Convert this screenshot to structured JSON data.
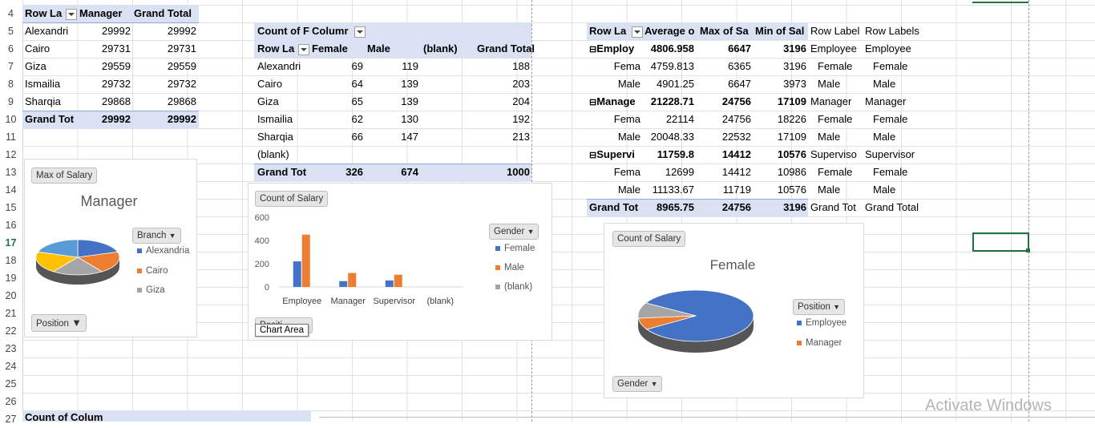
{
  "colors": {
    "blue": "#4472c4",
    "orange": "#ed7d31",
    "gray": "#a5a5a5",
    "yellow": "#ffc000",
    "lightblue": "#5b9bd5",
    "green": "#217346",
    "header_band": "#d9e1f2"
  },
  "row_numbers": [
    "4",
    "5",
    "6",
    "7",
    "8",
    "9",
    "10",
    "11",
    "12",
    "13",
    "14",
    "15",
    "16",
    "17",
    "18",
    "19",
    "20",
    "21",
    "22",
    "23",
    "24",
    "25",
    "26",
    "27"
  ],
  "pivot1": {
    "headers": [
      "Row La",
      "Manager",
      "Grand Total"
    ],
    "rows": [
      [
        "Alexandri",
        "29992",
        "29992"
      ],
      [
        "Cairo",
        "29731",
        "29731"
      ],
      [
        "Giza",
        "29559",
        "29559"
      ],
      [
        "Ismailia",
        "29732",
        "29732"
      ],
      [
        "Sharqia",
        "29868",
        "29868"
      ]
    ],
    "total": [
      "Grand Tot",
      "29992",
      "29992"
    ]
  },
  "pivot2": {
    "top_left": "Count of F",
    "top_right": "Columr",
    "headers": [
      "Row La",
      "Female",
      "Male",
      "(blank)",
      "Grand Total"
    ],
    "rows": [
      [
        "Alexandri",
        "69",
        "119",
        "",
        "188"
      ],
      [
        "Cairo",
        "64",
        "139",
        "",
        "203"
      ],
      [
        "Giza",
        "65",
        "139",
        "",
        "204"
      ],
      [
        "Ismailia",
        "62",
        "130",
        "",
        "192"
      ],
      [
        "Sharqia",
        "66",
        "147",
        "",
        "213"
      ],
      [
        "(blank)",
        "",
        "",
        "",
        ""
      ]
    ],
    "total": [
      "Grand Tot",
      "326",
      "674",
      "",
      "1000"
    ]
  },
  "pivot3": {
    "headers": [
      "Row La",
      "Average o",
      "Max of Sa",
      "Min of Sal",
      "Row Label",
      "Row Labels"
    ],
    "rows": [
      {
        "label": "Employ",
        "vals": [
          "4806.958",
          "6647",
          "3196"
        ],
        "e": "Employee",
        "f": "Employee",
        "group": true
      },
      {
        "label": "Fema",
        "vals": [
          "4759.813",
          "6365",
          "3196"
        ],
        "e": "Female",
        "f": "Female",
        "group": false
      },
      {
        "label": "Male",
        "vals": [
          "4901.25",
          "6647",
          "3973"
        ],
        "e": "Male",
        "f": "Male",
        "group": false
      },
      {
        "label": "Manage",
        "vals": [
          "21228.71",
          "24756",
          "17109"
        ],
        "e": "Manager",
        "f": "Manager",
        "group": true
      },
      {
        "label": "Fema",
        "vals": [
          "22114",
          "24756",
          "18226"
        ],
        "e": "Female",
        "f": "Female",
        "group": false
      },
      {
        "label": "Male",
        "vals": [
          "20048.33",
          "22532",
          "17109"
        ],
        "e": "Male",
        "f": "Male",
        "group": false
      },
      {
        "label": "Supervi",
        "vals": [
          "11759.8",
          "14412",
          "10576"
        ],
        "e": "Superviso",
        "f": "Supervisor",
        "group": true
      },
      {
        "label": "Fema",
        "vals": [
          "12699",
          "14412",
          "10986"
        ],
        "e": "Female",
        "f": "Female",
        "group": false
      },
      {
        "label": "Male",
        "vals": [
          "11133.67",
          "11719",
          "10576"
        ],
        "e": "Male",
        "f": "Male",
        "group": false
      }
    ],
    "total": {
      "label": "Grand Tot",
      "vals": [
        "8965.75",
        "24756",
        "3196"
      ],
      "e": "Grand Tot",
      "f": "Grand Total"
    }
  },
  "bottom_cut": "Count of  Colum",
  "chart1": {
    "button_top": "Max of Salary",
    "title": "Manager",
    "legend_button": "Branch",
    "legend": [
      "Alexandria",
      "Cairo",
      "Giza"
    ],
    "button_bottom": "Position"
  },
  "chart2": {
    "button_top": "Count of Salary",
    "legend_button": "Gender",
    "legend": [
      "Female",
      "Male",
      "(blank)"
    ],
    "tooltip": "Chart Area",
    "button_bottom": "Positi"
  },
  "chart3": {
    "button_top": "Count of Salary",
    "title": "Female",
    "legend_button": "Position",
    "legend": [
      "Employee",
      "Manager"
    ],
    "button_bottom": "Gender"
  },
  "chart_data": [
    {
      "type": "pie",
      "title": "Manager",
      "categories": [
        "Alexandria",
        "Cairo",
        "Giza",
        "Ismailia",
        "Sharqia"
      ],
      "values": [
        29992,
        29731,
        29559,
        29732,
        29868
      ]
    },
    {
      "type": "bar",
      "title": "",
      "categories": [
        "Employee",
        "Manager",
        "Supervisor",
        "(blank)"
      ],
      "series": [
        {
          "name": "Female",
          "values": [
            220,
            50,
            56,
            0
          ]
        },
        {
          "name": "Male",
          "values": [
            450,
            120,
            105,
            0
          ]
        },
        {
          "name": "(blank)",
          "values": [
            0,
            0,
            0,
            0
          ]
        }
      ],
      "ylim": [
        0,
        600
      ],
      "yticks": [
        "600",
        "400",
        "200",
        "0"
      ]
    },
    {
      "type": "pie",
      "title": "Female",
      "categories": [
        "Employee",
        "Manager",
        "Supervisor"
      ],
      "values": [
        270,
        24,
        32
      ]
    }
  ],
  "watermark": "Activate Windows"
}
